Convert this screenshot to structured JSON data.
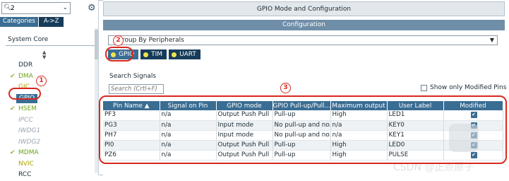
{
  "left_panel": {
    "search_value": "2",
    "tabs": [
      "Categories",
      "A->Z"
    ],
    "section_title": "System Core",
    "tree_items": [
      {
        "label": "DDR",
        "style": "normal",
        "checked": false
      },
      {
        "label": "DMA",
        "style": "green",
        "checked": true
      },
      {
        "label": "GIC",
        "style": "yellow",
        "checked": false
      },
      {
        "label": "GPIO",
        "style": "selected",
        "checked": false
      },
      {
        "label": "HSEM",
        "style": "green",
        "checked": true
      },
      {
        "label": "IPCC",
        "style": "gray",
        "checked": false
      },
      {
        "label": "IWDG1",
        "style": "gray",
        "checked": false
      },
      {
        "label": "IWDG2",
        "style": "gray",
        "checked": false
      },
      {
        "label": "MDMA",
        "style": "green",
        "checked": true
      },
      {
        "label": "NVIC",
        "style": "yellow",
        "checked": false
      },
      {
        "label": "RCC",
        "style": "normal",
        "checked": false
      }
    ]
  },
  "right_panel": {
    "title": "GPIO Mode and Configuration",
    "subtitle": "Configuration",
    "group_by": "Group By Peripherals",
    "mode_tabs": [
      "GPIO",
      "TIM",
      "UART"
    ],
    "search_label": "Search Signals",
    "search_placeholder": "Search (Crtl+F)",
    "show_modified_label": "Show only Modified Pins",
    "table": {
      "headers": [
        "Pin Name",
        "Signal on Pin",
        "GPIO mode",
        "GPIO Pull-up/Pull...",
        "Maximum output",
        "User Label",
        "Modified"
      ],
      "rows": [
        [
          "PF3",
          "n/a",
          "Output Push Pull",
          "Pull-up",
          "High",
          "LED1"
        ],
        [
          "PG3",
          "n/a",
          "Input mode",
          "No pull-up and no...",
          "n/a",
          "KEY0"
        ],
        [
          "PH7",
          "n/a",
          "Input mode",
          "No pull-up and no...",
          "n/a",
          "KEY1"
        ],
        [
          "PI0",
          "n/a",
          "Output Push Pull",
          "Pull-up",
          "High",
          "LED0"
        ],
        [
          "PZ6",
          "n/a",
          "Output Push Pull",
          "Pull-up",
          "High",
          "PULSE"
        ]
      ]
    }
  },
  "annotations": [
    "1",
    "2",
    "3"
  ],
  "watermark": "CSDN @正点原子",
  "colors": {
    "accent": "#3a6d93",
    "dark": "#173c5a",
    "annotation": "#d9281e",
    "check_green": "#8ab92d"
  }
}
